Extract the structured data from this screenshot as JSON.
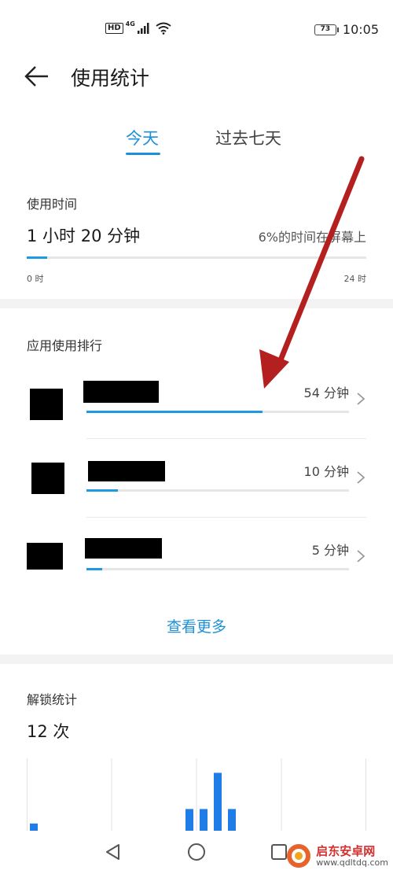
{
  "status_bar": {
    "hd": "HD",
    "network": "4G",
    "battery": "73",
    "time": "10:05"
  },
  "header": {
    "title": "使用统计",
    "back_icon": "arrow-left-icon"
  },
  "tabs": [
    {
      "label": "今天",
      "active": true
    },
    {
      "label": "过去七天",
      "active": false
    }
  ],
  "usage": {
    "label": "使用时间",
    "value": "1 小时 20 分钟",
    "percent_text": "6%的时间在屏幕上",
    "progress_fraction": 0.06,
    "axis_start": "0 时",
    "axis_end": "24 时"
  },
  "app_ranking": {
    "label": "应用使用排行",
    "apps": [
      {
        "duration": "54 分钟",
        "fraction": 0.67
      },
      {
        "duration": "10 分钟",
        "fraction": 0.12
      },
      {
        "duration": "5 分钟",
        "fraction": 0.06
      }
    ],
    "see_more": "查看更多"
  },
  "unlock": {
    "label": "解锁统计",
    "value": "12 次"
  },
  "chart_data": {
    "type": "bar",
    "values": [
      1,
      0,
      0,
      0,
      0,
      0,
      0,
      0,
      0,
      0,
      0,
      3,
      3,
      8,
      3,
      0,
      0,
      0,
      0,
      0,
      0,
      0,
      0,
      0
    ],
    "ylim": [
      0,
      10
    ],
    "title": "",
    "xlabel": "",
    "ylabel": ""
  },
  "nav_bar": {
    "back": "triangle-back-icon",
    "home": "circle-home-icon",
    "recents": "square-recents-icon"
  },
  "watermark": {
    "name": "启东安卓网",
    "url": "www.qdltdq.com"
  },
  "colors": {
    "accent": "#1e90d8",
    "bar": "#1e7de6",
    "annotation_arrow": "#b3201f"
  }
}
